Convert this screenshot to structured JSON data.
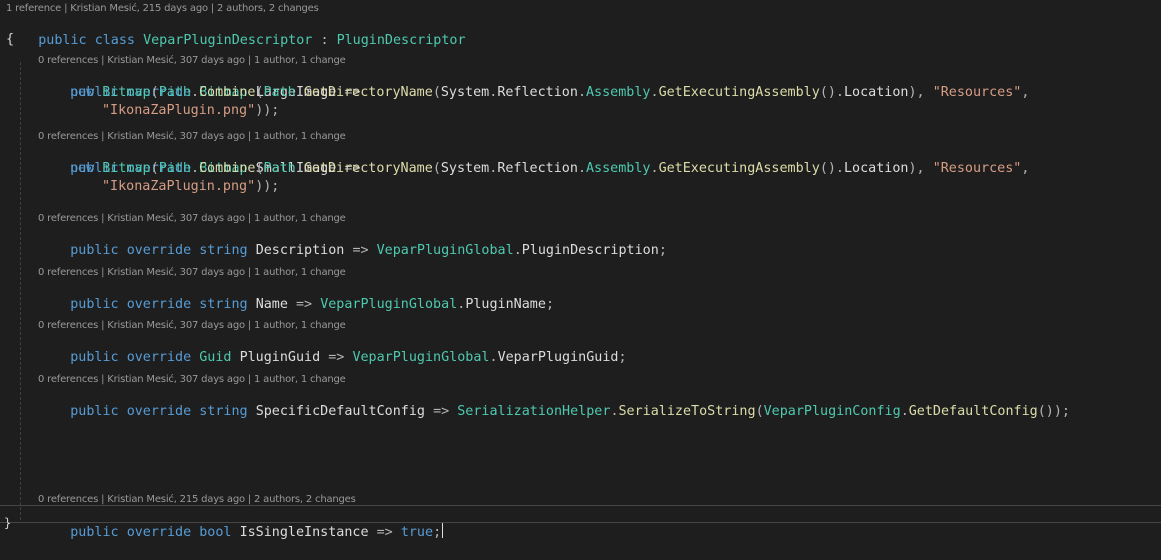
{
  "lens": {
    "class": "1 reference | Kristian Mesić, 215 days ago | 2 authors, 2 changes",
    "large_image": "0 references | Kristian Mesić, 307 days ago | 1 author, 1 change",
    "small_image": "0 references | Kristian Mesić, 307 days ago | 1 author, 1 change",
    "description": "0 references | Kristian Mesić, 307 days ago | 1 author, 1 change",
    "name": "0 references | Kristian Mesić, 307 days ago | 1 author, 1 change",
    "plugin_guid": "0 references | Kristian Mesić, 307 days ago | 1 author, 1 change",
    "specific_default_config": "0 references | Kristian Mesić, 307 days ago | 1 author, 1 change",
    "is_single_instance": "0 references | Kristian Mesić, 215 days ago | 2 authors, 2 changes"
  },
  "code": {
    "class_decl": {
      "public": "public",
      "class": "class",
      "name": "VeparPluginDescriptor",
      "colon": ":",
      "base": "PluginDescriptor"
    },
    "open_brace": "{",
    "large_image": {
      "line1": {
        "public": "public",
        "override": "override",
        "type": "Bitmap",
        "name": "LargeImage",
        "arrow": "=>"
      },
      "line2": {
        "new": "new",
        "bitmap": "Bitmap",
        "p1": "(",
        "path": "Path",
        "d1": ".",
        "combine": "Combine",
        "p2": "(",
        "path2": "Path",
        "d2": ".",
        "getdir": "GetDirectoryName",
        "p3": "(",
        "system": "System",
        "d3": ".",
        "reflection": "Reflection",
        "d4": ".",
        "assembly": "Assembly",
        "d5": ".",
        "getexec": "GetExecutingAssembly",
        "p4": "().",
        "location": "Location",
        "p5": "), ",
        "resources": "\"Resources\"",
        "comma": ","
      },
      "line3": {
        "file": "\"IkonaZaPlugin.png\"",
        "end": "));"
      }
    },
    "small_image": {
      "line1": {
        "public": "public",
        "override": "override",
        "type": "Bitmap",
        "name": "SmallImage",
        "arrow": "=>"
      },
      "line2": {
        "new": "new",
        "bitmap": "Bitmap",
        "p1": "(",
        "path": "Path",
        "d1": ".",
        "combine": "Combine",
        "p2": "(",
        "path2": "Path",
        "d2": ".",
        "getdir": "GetDirectoryName",
        "p3": "(",
        "system": "System",
        "d3": ".",
        "reflection": "Reflection",
        "d4": ".",
        "assembly": "Assembly",
        "d5": ".",
        "getexec": "GetExecutingAssembly",
        "p4": "().",
        "location": "Location",
        "p5": "), ",
        "resources": "\"Resources\"",
        "comma": ","
      },
      "line3": {
        "file": "\"IkonaZaPlugin.png\"",
        "end": "));"
      }
    },
    "description": {
      "public": "public",
      "override": "override",
      "type": "string",
      "name": "Description",
      "arrow": "=>",
      "global": "VeparPluginGlobal",
      "dot": ".",
      "member": "PluginDescription",
      "semi": ";"
    },
    "name": {
      "public": "public",
      "override": "override",
      "type": "string",
      "name": "Name",
      "arrow": "=>",
      "global": "VeparPluginGlobal",
      "dot": ".",
      "member": "PluginName",
      "semi": ";"
    },
    "plugin_guid": {
      "public": "public",
      "override": "override",
      "type": "Guid",
      "name": "PluginGuid",
      "arrow": "=>",
      "global": "VeparPluginGlobal",
      "dot": ".",
      "member": "VeparPluginGuid",
      "semi": ";"
    },
    "specific_default_config": {
      "public": "public",
      "override": "override",
      "type": "string",
      "name": "SpecificDefaultConfig",
      "arrow": "=>",
      "helper": "SerializationHelper",
      "dot": ".",
      "method": "SerializeToString",
      "p1": "(",
      "config": "VeparPluginConfig",
      "dot2": ".",
      "method2": "GetDefaultConfig",
      "end": "());"
    },
    "is_single_instance": {
      "public": "public",
      "override": "override",
      "type": "bool",
      "name": "IsSingleInstance",
      "arrow": "=>",
      "value": "true",
      "semi": ";"
    },
    "close_brace": "}"
  }
}
